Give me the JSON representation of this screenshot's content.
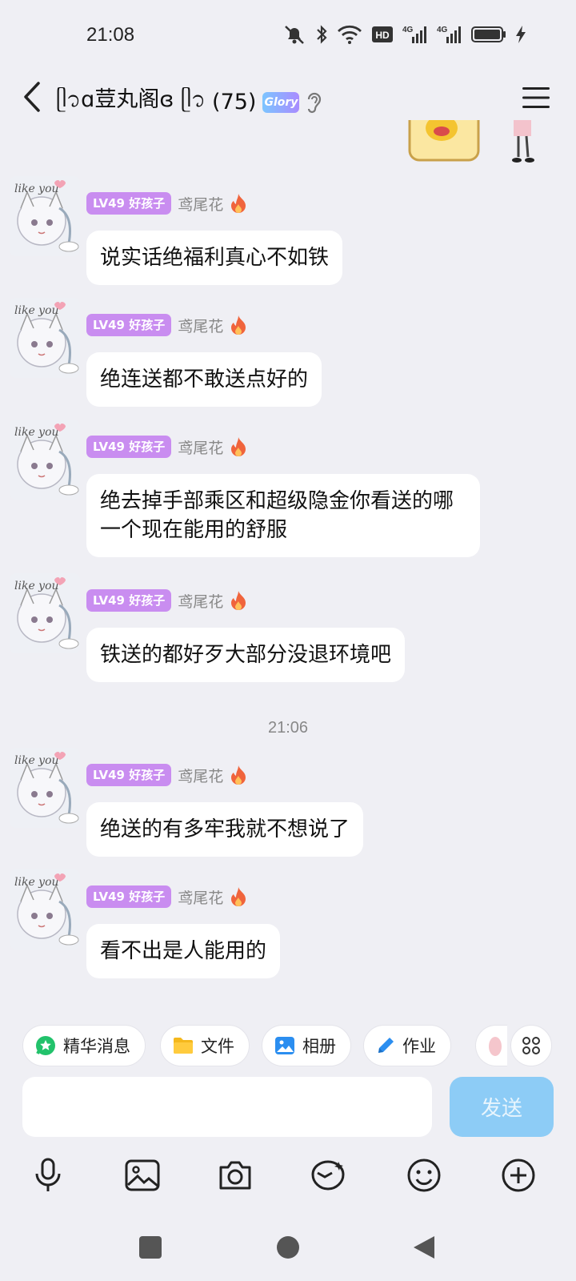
{
  "status_bar": {
    "time": "21:08",
    "icons": [
      "mute-icon",
      "bluetooth-icon",
      "wifi-icon",
      "hd-icon",
      "signal-4g-icon",
      "signal-4g-icon",
      "battery-icon",
      "charging-icon"
    ],
    "hd_label": "HD",
    "net_label_1": "4G",
    "net_label_2": "4G"
  },
  "header": {
    "title": "ᥫ᭡ɑ荳丸阁ɞ ᥫ᭡",
    "member_count": "(75)",
    "badge_text": "Glory"
  },
  "messages": [
    {
      "level": "LV49 好孩子",
      "sender": "鸢尾花",
      "text": "说实话绝福利真心不如铁"
    },
    {
      "level": "LV49 好孩子",
      "sender": "鸢尾花",
      "text": "绝连送都不敢送点好的"
    },
    {
      "level": "LV49 好孩子",
      "sender": "鸢尾花",
      "text": "绝去掉手部乘区和超级隐金你看送的哪一个现在能用的舒服"
    },
    {
      "level": "LV49 好孩子",
      "sender": "鸢尾花",
      "text": "铁送的都好歹大部分没退环境吧"
    },
    {
      "level": "LV49 好孩子",
      "sender": "鸢尾花",
      "text": "绝送的有多牢我就不想说了"
    },
    {
      "level": "LV49 好孩子",
      "sender": "鸢尾花",
      "text": "看不出是人能用的"
    }
  ],
  "time_divider": "21:06",
  "chips": [
    {
      "label": "精华消息",
      "icon": "star-chat-icon"
    },
    {
      "label": "文件",
      "icon": "folder-icon"
    },
    {
      "label": "相册",
      "icon": "album-icon"
    },
    {
      "label": "作业",
      "icon": "pen-icon"
    }
  ],
  "input": {
    "value": "",
    "placeholder": ""
  },
  "send_label": "发送",
  "tools": [
    "microphone-icon",
    "image-icon",
    "camera-icon",
    "red-packet-icon",
    "emoji-icon",
    "plus-icon"
  ],
  "nav": [
    "recent-apps-icon",
    "home-icon",
    "back-triangle-icon"
  ],
  "colors": {
    "accent": "#8dccf6",
    "level_badge": "#c98df0",
    "background": "#efeff4"
  }
}
